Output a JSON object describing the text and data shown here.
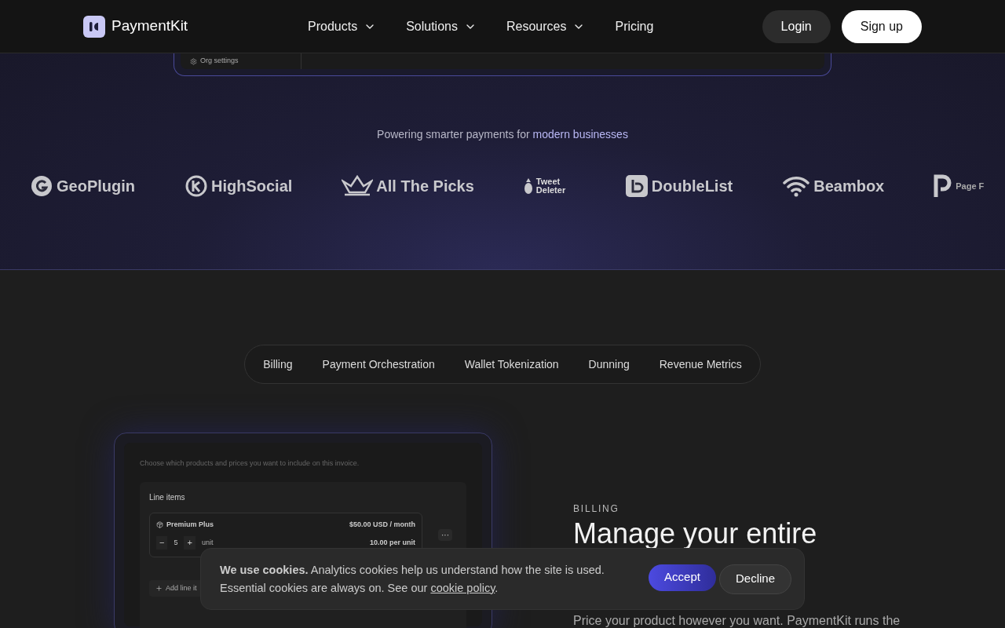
{
  "nav": {
    "brand": "PaymentKit",
    "links": [
      {
        "label": "Products",
        "dropdown": true
      },
      {
        "label": "Solutions",
        "dropdown": true
      },
      {
        "label": "Resources",
        "dropdown": true
      },
      {
        "label": "Pricing",
        "dropdown": false
      }
    ],
    "login": "Login",
    "signup": "Sign up"
  },
  "hero_preview": {
    "sidebar_item": "Org settings"
  },
  "trusted": {
    "text": "Powering smarter payments for ",
    "highlight": "modern businesses",
    "logos": [
      {
        "name": "GeoPlugin",
        "kind": "g"
      },
      {
        "name": "HighSocial",
        "kind": "h"
      },
      {
        "name": "All The Picks",
        "kind": "crown"
      },
      {
        "name": "Tweet Deleter",
        "kind": "bomb"
      },
      {
        "name": "DoubleList",
        "kind": "d"
      },
      {
        "name": "Beambox",
        "kind": "wifi"
      },
      {
        "name": "Page F",
        "kind": "p"
      }
    ]
  },
  "feature_tabs": [
    "Billing",
    "Payment Orchestration",
    "Wallet Tokenization",
    "Dunning",
    "Revenue Metrics"
  ],
  "invoice_preview": {
    "hint": "Choose which products and prices you want to include on this invoice.",
    "section": "Line items",
    "item": {
      "name": "Premium Plus",
      "price": "$50.00 USD / month",
      "minus": "−",
      "qty": "5",
      "plus": "+",
      "unit": "unit",
      "unit_price": "10.00 per unit"
    },
    "more": "···",
    "add": "Add line it"
  },
  "feature": {
    "eyebrow": "BILLING",
    "title": "Manage your entire",
    "body": "Price your product however you want. PaymentKit runs the"
  },
  "cookie": {
    "text": "**We use cookies.** Analytics cookies help us understand how the site is used. Essential cookies are always on. See our ",
    "link": "cookie policy",
    "end": ".",
    "accept": "Accept",
    "decline": "Decline"
  }
}
